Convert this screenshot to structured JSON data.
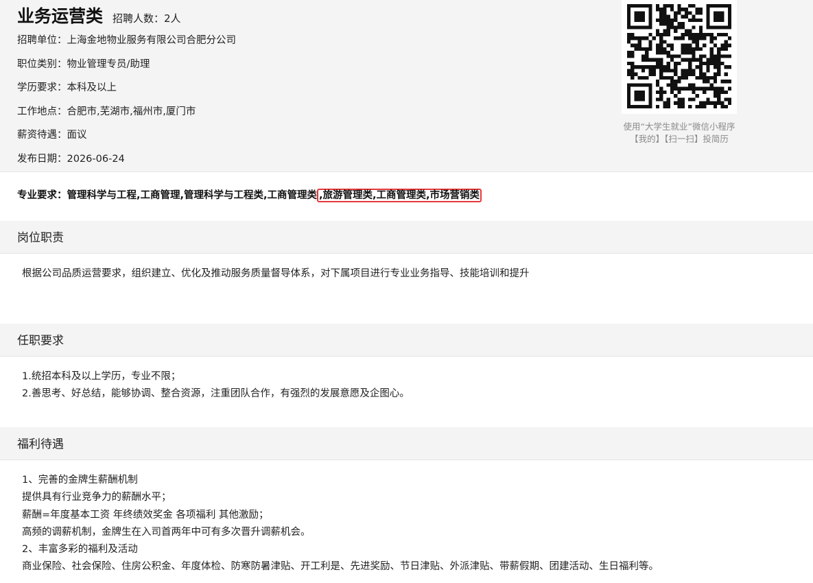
{
  "job": {
    "title": "业务运营类",
    "hire_count": "招聘人数：2人",
    "info": [
      "招聘单位：上海金地物业服务有限公司合肥分公司",
      "职位类别：物业管理专员/助理",
      "学历要求：本科及以上",
      "工作地点：合肥市,芜湖市,福州市,厦门市",
      "薪资待遇：面议",
      "发布日期：2026-06-24"
    ]
  },
  "qr": {
    "icon": "qr-code-icon",
    "caption_line1": "使用“大学生就业”微信小程序",
    "caption_line2": "【我的】【扫一扫】投简历"
  },
  "major": {
    "label": "专业要求：",
    "prefix": "管理科学与工程,工商管理,管理科学与工程类,工商管理类",
    "highlighted": ",旅游管理类,工商管理类,市场营销类",
    "highlight_color": "#e8363a"
  },
  "sections": {
    "duties": {
      "title": "岗位职责",
      "lines": [
        "根据公司品质运营要求，组织建立、优化及推动服务质量督导体系，对下属项目进行专业业务指导、技能培训和提升"
      ]
    },
    "requirements": {
      "title": "任职要求",
      "lines": [
        "1.统招本科及以上学历，专业不限；",
        "2.善思考、好总结，能够协调、整合资源，注重团队合作，有强烈的发展意愿及企图心。"
      ]
    },
    "benefits": {
      "title": "福利待遇",
      "lines": [
        "1、完善的金牌生薪酬机制",
        "提供具有行业竞争力的薪酬水平；",
        "薪酬=年度基本工资 年终绩效奖金 各项福利 其他激励；",
        "高频的调薪机制，金牌生在入司首两年中可有多次晋升调薪机会。",
        "2、丰富多彩的福利及活动",
        "商业保险、社会保险、住房公积金、年度体检、防寒防暑津贴、开工利是、先进奖励、节日津贴、外派津贴、带薪假期、团建活动、生日福利等。"
      ]
    }
  }
}
